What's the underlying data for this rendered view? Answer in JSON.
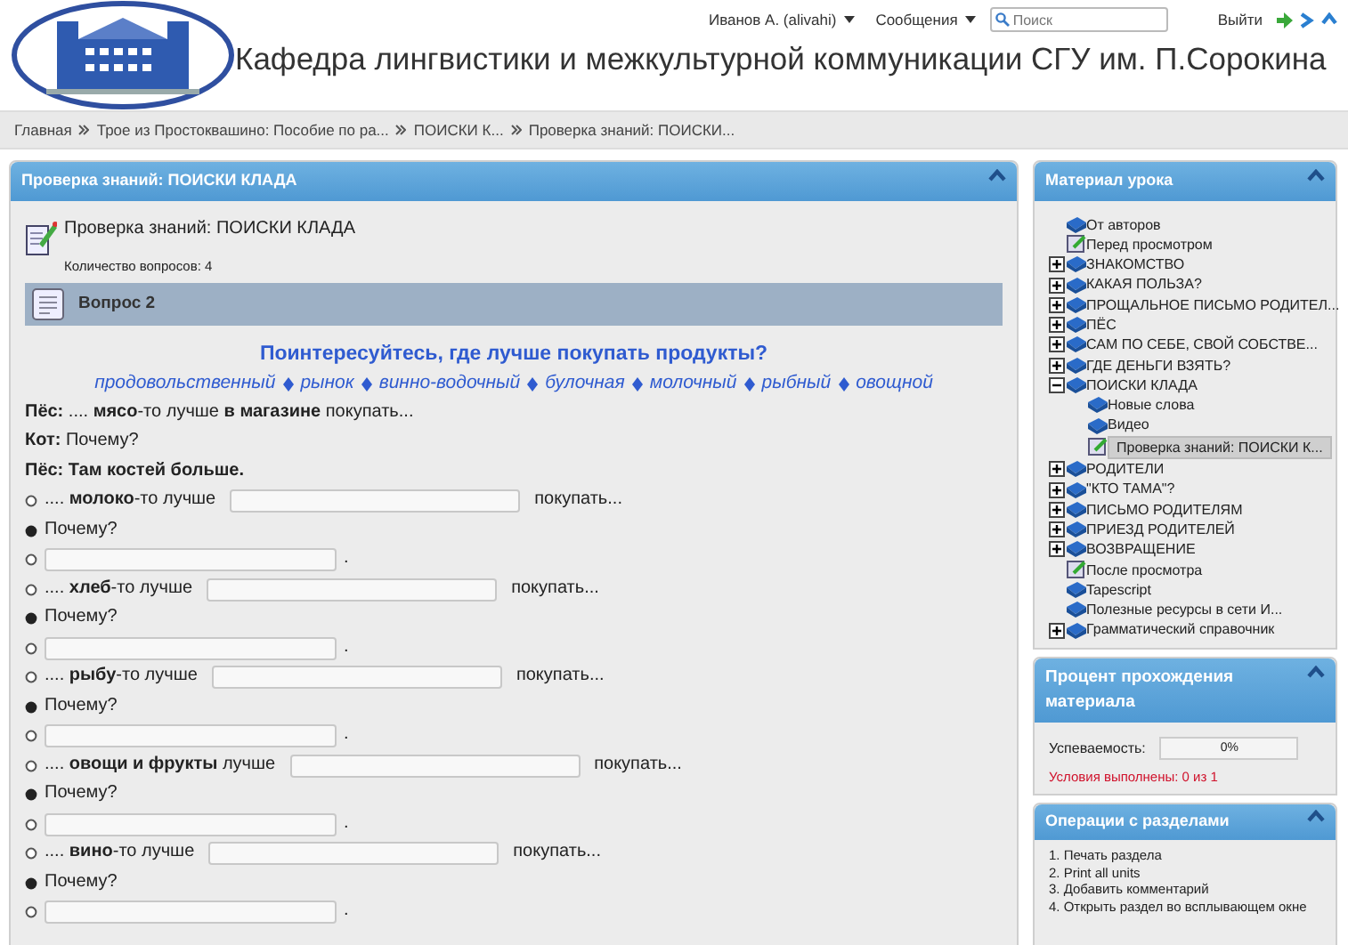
{
  "header": {
    "title": "Кафедра лингвистики и межкультурной коммуникации СГУ им. П.Сорокина",
    "user_menu": "Иванов А. (alivahi)",
    "messages_menu": "Сообщения",
    "search": {
      "placeholder": "Поиск"
    },
    "logout": "Выйти"
  },
  "breadcrumbs": [
    "Главная",
    "Трое из Простоквашино: Пособие по ра...",
    "ПОИСКИ К...",
    "Проверка знаний: ПОИСКИ..."
  ],
  "main": {
    "panel_title": "Проверка знаний: ПОИСКИ КЛАДА",
    "quiz_title": "Проверка знаний: ПОИСКИ КЛАДА",
    "question_count": "Количество вопросов: 4",
    "question_label": "Вопрос 2",
    "prompt": "Поинтересуйтесь, где лучше покупать продукты?",
    "word_bank": [
      "продовольственный",
      "рынок",
      "винно-водочный",
      "булочная",
      "молочный",
      "рыбный",
      "овощной"
    ],
    "dialogue": [
      "**Пёс:** .... **мясо**-то лучше **в магазине** покупать...",
      "**Кот:** Почему?",
      "**Пёс: Там костей больше.**"
    ],
    "rows": [
      {
        "kind": "statement",
        "before": ".... **молоко**-то лучше",
        "after": "покупать..."
      },
      {
        "kind": "question",
        "text": "Почему?"
      },
      {
        "kind": "answer",
        "after": "."
      },
      {
        "kind": "statement",
        "before": ".... **хлеб**-то лучше",
        "after": "покупать..."
      },
      {
        "kind": "question",
        "text": "Почему?"
      },
      {
        "kind": "answer",
        "after": "."
      },
      {
        "kind": "statement",
        "before": ".... **рыбу**-то лучше",
        "after": "покупать..."
      },
      {
        "kind": "question",
        "text": "Почему?"
      },
      {
        "kind": "answer",
        "after": "."
      },
      {
        "kind": "statement",
        "before": ".... **овощи и фрукты** лучше",
        "after": "покупать..."
      },
      {
        "kind": "question",
        "text": "Почему?"
      },
      {
        "kind": "answer",
        "after": "."
      },
      {
        "kind": "statement",
        "before": ".... **вино**-то лучше",
        "after": "покупать..."
      },
      {
        "kind": "question",
        "text": "Почему?"
      },
      {
        "kind": "answer",
        "after": "."
      }
    ]
  },
  "lesson": {
    "title": "Материал урока",
    "items": [
      {
        "kind": "resource",
        "label": "От авторов",
        "selected": false
      },
      {
        "kind": "quiz",
        "label": "Перед просмотром",
        "selected": false
      },
      {
        "kind": "section",
        "label": "ЗНАКОМСТВО",
        "expanded": false,
        "selected": false
      },
      {
        "kind": "section",
        "label": "КАКАЯ ПОЛЬЗА?",
        "expanded": false,
        "selected": false
      },
      {
        "kind": "section",
        "label": "ПРОЩАЛЬНОЕ ПИСЬМО РОДИТЕЛ...",
        "expanded": false,
        "selected": false
      },
      {
        "kind": "section",
        "label": "ПЁС",
        "expanded": false,
        "selected": false
      },
      {
        "kind": "section",
        "label": "САМ ПО СЕБЕ, СВОЙ СОБСТВЕ...",
        "expanded": false,
        "selected": false
      },
      {
        "kind": "section",
        "label": "ГДЕ ДЕНЬГИ ВЗЯТЬ?",
        "expanded": false,
        "selected": false
      },
      {
        "kind": "section",
        "label": "ПОИСКИ КЛАДА",
        "expanded": true,
        "selected": false,
        "children": [
          {
            "kind": "resource",
            "label": "Новые слова",
            "selected": false
          },
          {
            "kind": "resource",
            "label": "Видео",
            "selected": false
          },
          {
            "kind": "quiz",
            "label": "Проверка знаний: ПОИСКИ К...",
            "selected": true
          }
        ]
      },
      {
        "kind": "section",
        "label": "РОДИТЕЛИ",
        "expanded": false,
        "selected": false
      },
      {
        "kind": "section",
        "label": "\"КТО ТАМА\"?",
        "expanded": false,
        "selected": false
      },
      {
        "kind": "section",
        "label": "ПИСЬМО РОДИТЕЛЯМ",
        "expanded": false,
        "selected": false
      },
      {
        "kind": "section",
        "label": "ПРИЕЗД РОДИТЕЛЕЙ",
        "expanded": false,
        "selected": false
      },
      {
        "kind": "section",
        "label": "ВОЗВРАЩЕНИЕ",
        "expanded": false,
        "selected": false
      },
      {
        "kind": "quiz",
        "label": "После просмотра",
        "selected": false
      },
      {
        "kind": "resource",
        "label": "Tapescript",
        "selected": false
      },
      {
        "kind": "resource",
        "label": "Полезные ресурсы в сети И...",
        "selected": false
      },
      {
        "kind": "section",
        "label": "Грамматический справочник",
        "expanded": false,
        "selected": false
      }
    ]
  },
  "progress": {
    "title": "Процент прохождения материала",
    "label": "Успеваемость:",
    "level": 0,
    "reading": "0%",
    "conditions": "Условия выполнены: 0 из 1"
  },
  "operations": {
    "title": "Операции с разделами",
    "items": [
      "1. Печать раздела",
      "2. Print all units",
      "3. Добавить комментарий",
      "4. Открыть раздел во всплывающем окне"
    ]
  }
}
